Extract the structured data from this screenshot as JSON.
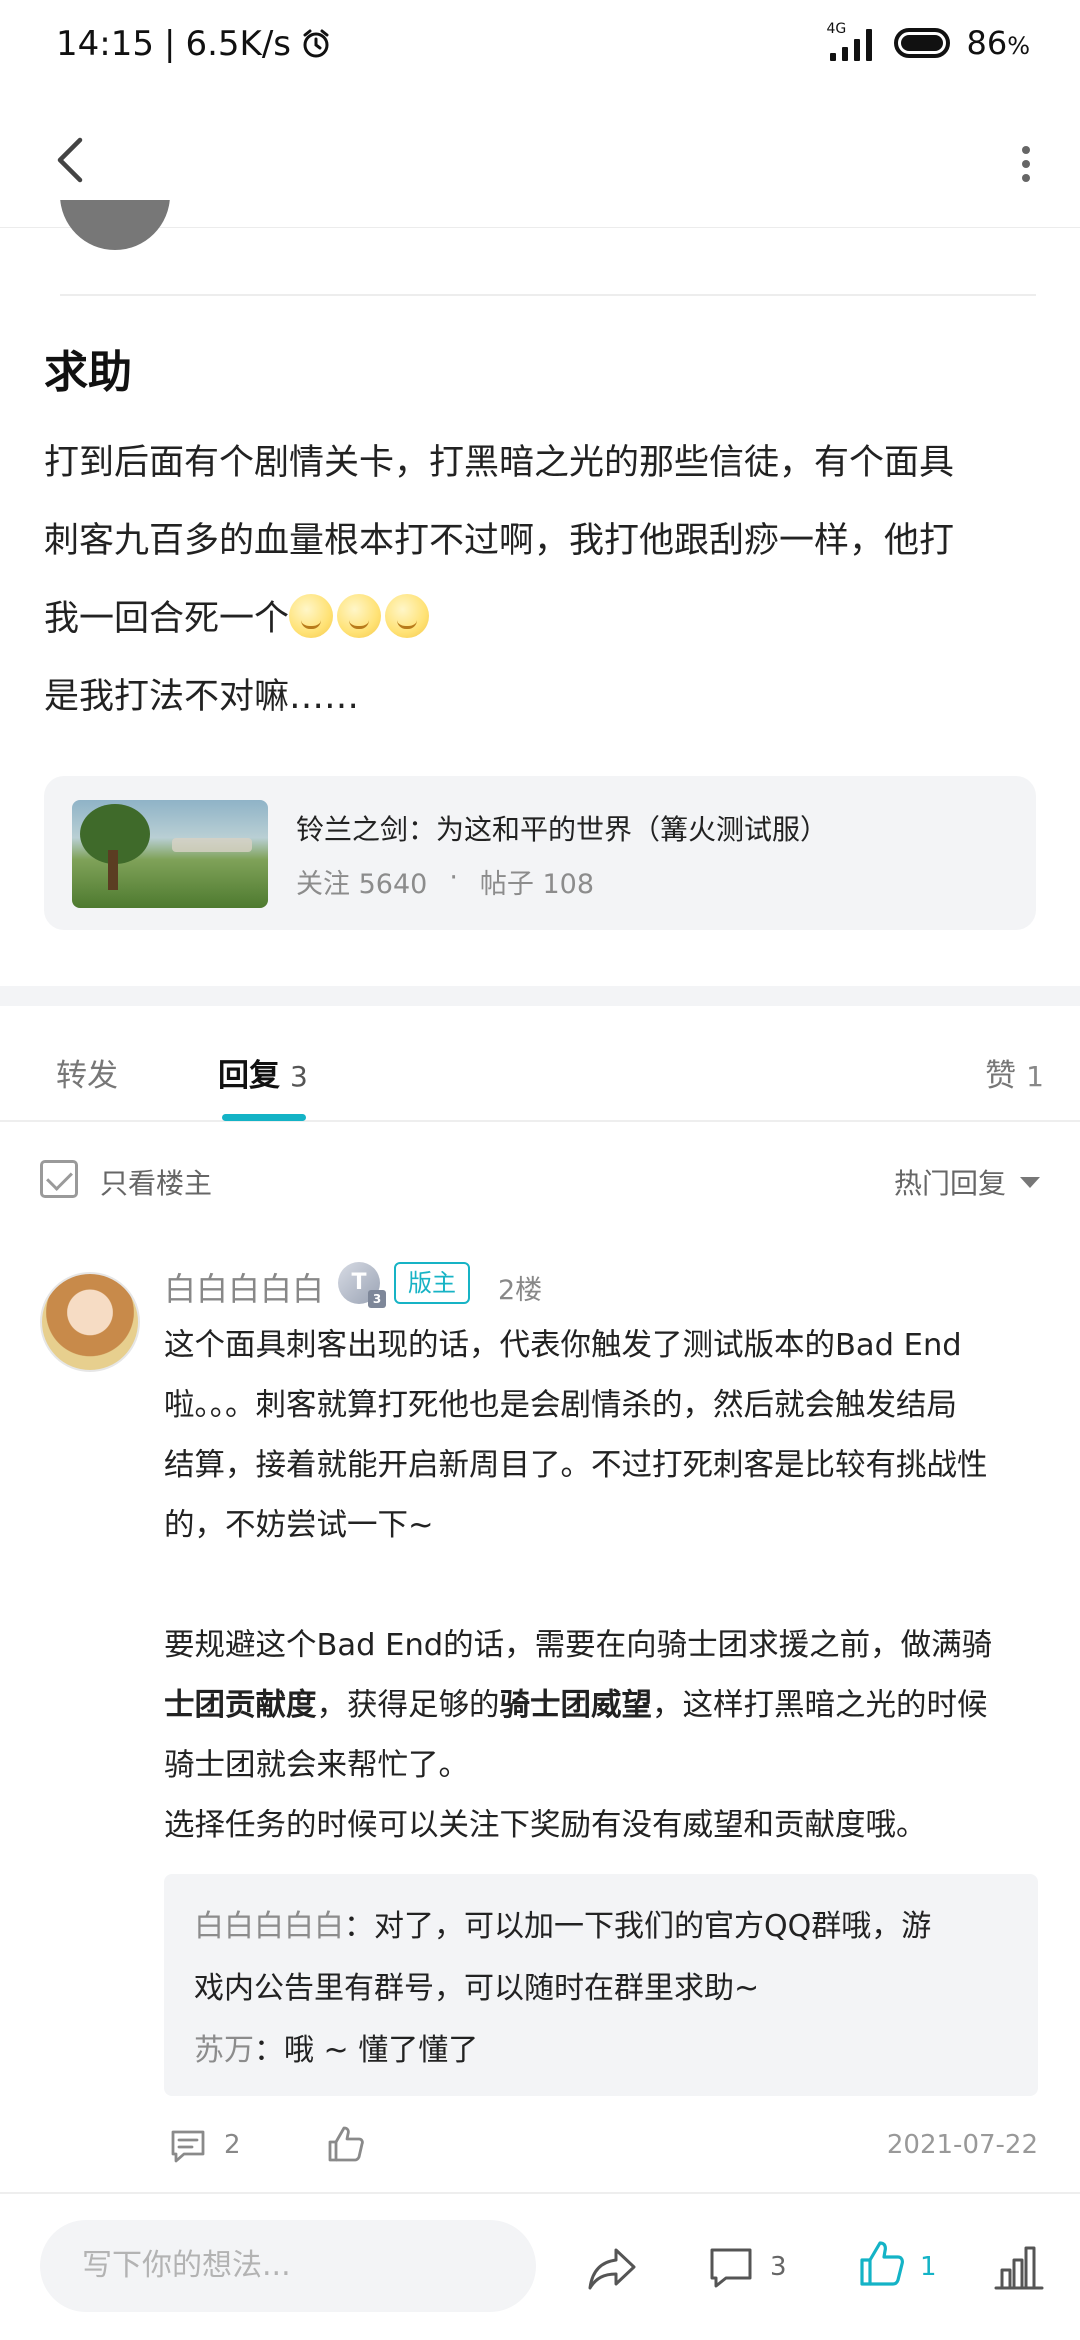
{
  "status_bar": {
    "time": "14:15",
    "separator": "|",
    "network_speed": "6.5K/s",
    "network_type": "4G",
    "battery_percent": "86",
    "battery_unit": "%"
  },
  "nav": {
    "back_icon": "chevron-left-icon",
    "more_icon": "more-vertical-icon"
  },
  "post": {
    "title": "求助",
    "body_line1": "打到后面有个剧情关卡，打黑暗之光的那些信徒，有个面具",
    "body_line2": "刺客九百多的血量根本打不过啊，我打他跟刮痧一样，他打",
    "body_line3": "我一回合死一个",
    "body_line4": "是我打法不对嘛……",
    "emoji_name": "smirk-moon-face-emoji",
    "emoji_count": 3
  },
  "game_card": {
    "name": "铃兰之剑：为这和平的世界（篝火测试服）",
    "follow_label": "关注",
    "follow_count": "5640",
    "dot": "·",
    "posts_label": "帖子",
    "posts_count": "108"
  },
  "tabs": {
    "forward": "转发",
    "reply": "回复",
    "reply_count": "3",
    "like": "赞",
    "like_count": "1"
  },
  "filter": {
    "only_op": "只看楼主",
    "sort_label": "热门回复"
  },
  "reply": {
    "author": "白白白白白",
    "level_badge": "T",
    "level_sub": "3",
    "mod_badge": "版主",
    "floor": "2楼",
    "p1_line1": "这个面具刺客出现的话，代表你触发了测试版本的Bad End",
    "p1_line2": "啦。。。刺客就算打死他也是会剧情杀的，然后就会触发结局",
    "p1_line3": "结算，接着就能开启新周目了。不过打死刺客是比较有挑战性",
    "p1_line4": "的，不妨尝试一下~",
    "p2_line1": "要规避这个Bad End的话，需要在向骑士团求援之前，做满骑",
    "p2_line2_bold": "士团贡献度",
    "p2_line2_mid": "，获得足够的",
    "p2_line2_bold2": "骑士团威望",
    "p2_line2_tail": "，这样打黑暗之光的时候",
    "p2_line3": "骑士团就会来帮忙了。",
    "p3_line1": "选择任务的时候可以关注下奖励有没有威望和贡献度哦。",
    "sub1_author": "白白白白白",
    "sub1_colon": "：",
    "sub1_text_line1": "对了，可以加一下我们的官方QQ群哦，游",
    "sub1_text_line2": "戏内公告里有群号，可以随时在群里求助~",
    "sub2_author": "苏万",
    "sub2_colon": "：",
    "sub2_text": "哦 ~ 懂了懂了",
    "comment_count": "2",
    "date": "2021-07-22"
  },
  "bottom_bar": {
    "input_placeholder": "写下你的想法...",
    "comment_count": "3",
    "like_count": "1"
  },
  "colors": {
    "accent": "#14b3c6",
    "muted": "#888888",
    "card_bg": "#f3f4f6"
  }
}
